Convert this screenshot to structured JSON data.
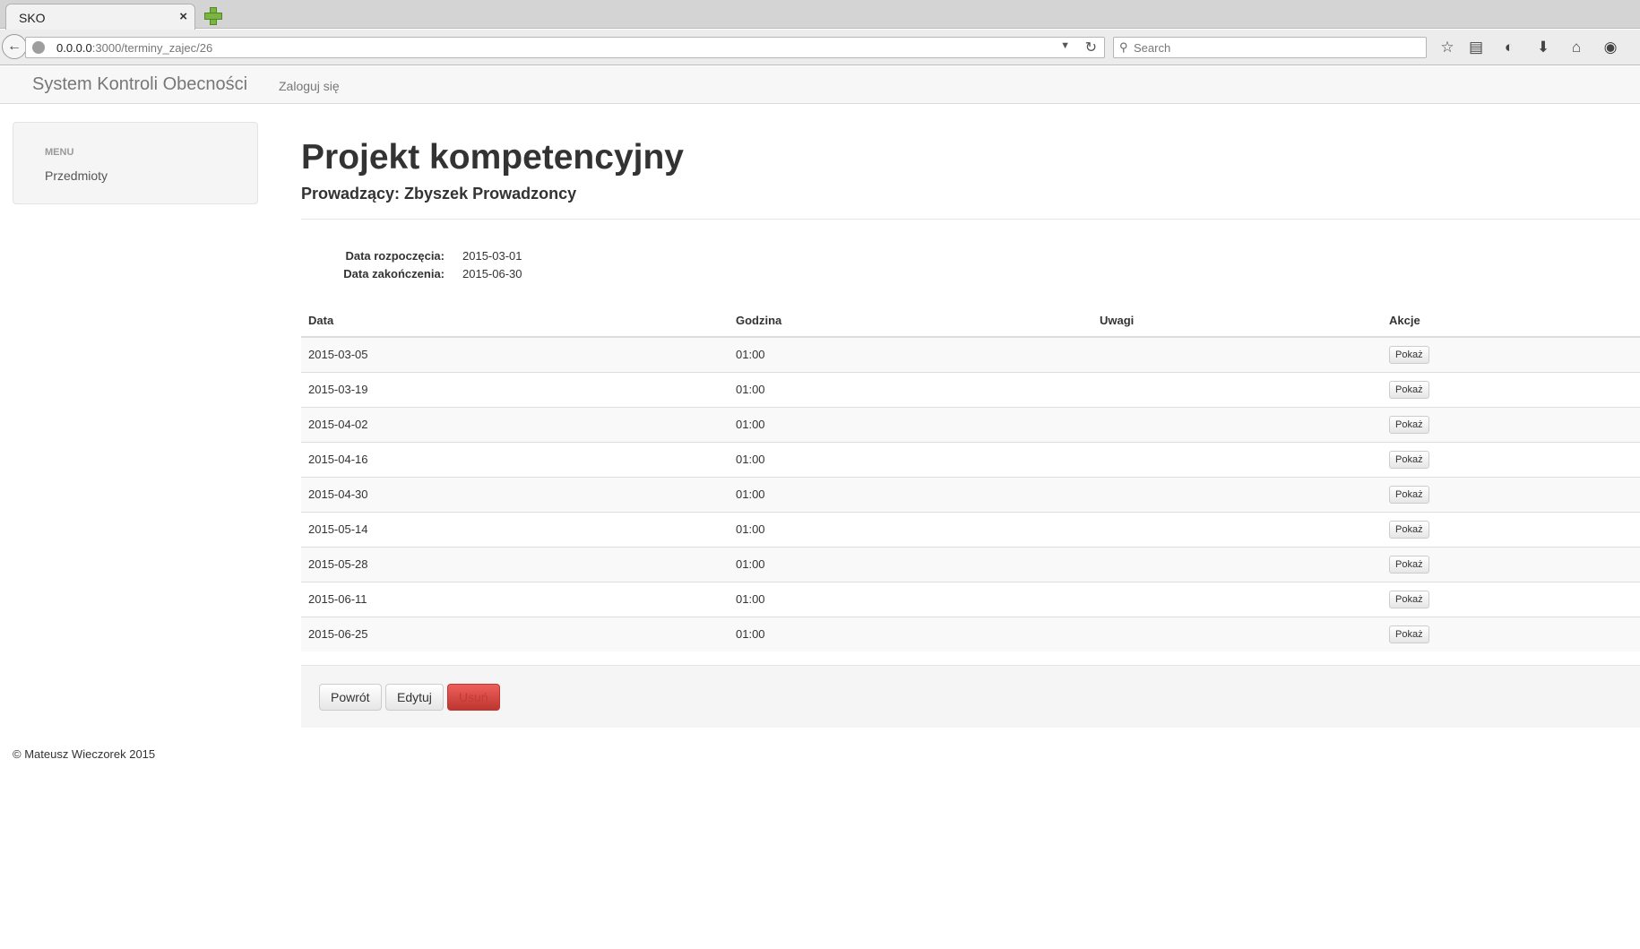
{
  "browser": {
    "tab_title": "SKO",
    "tab_close": "×",
    "url_host": "0.0.0.0",
    "url_path": ":3000/terminy_zajec/26",
    "search_placeholder": "Search"
  },
  "header": {
    "brand": "System Kontroli Obecności",
    "login_link": "Zaloguj się"
  },
  "sidebar": {
    "menu_header": "MENU",
    "items": [
      {
        "label": "Przedmioty"
      }
    ]
  },
  "main": {
    "title": "Projekt kompetencyjny",
    "subtitle": "Prowadzący: Zbyszek Prowadzoncy",
    "details": [
      {
        "label": "Data rozpoczęcia:",
        "value": "2015-03-01"
      },
      {
        "label": "Data zakończenia:",
        "value": "2015-06-30"
      }
    ],
    "table": {
      "headers": [
        "Data",
        "Godzina",
        "Uwagi",
        "Akcje"
      ],
      "rows": [
        {
          "date": "2015-03-05",
          "time": "01:00",
          "notes": "",
          "action": "Pokaż"
        },
        {
          "date": "2015-03-19",
          "time": "01:00",
          "notes": "",
          "action": "Pokaż"
        },
        {
          "date": "2015-04-02",
          "time": "01:00",
          "notes": "",
          "action": "Pokaż"
        },
        {
          "date": "2015-04-16",
          "time": "01:00",
          "notes": "",
          "action": "Pokaż"
        },
        {
          "date": "2015-04-30",
          "time": "01:00",
          "notes": "",
          "action": "Pokaż"
        },
        {
          "date": "2015-05-14",
          "time": "01:00",
          "notes": "",
          "action": "Pokaż"
        },
        {
          "date": "2015-05-28",
          "time": "01:00",
          "notes": "",
          "action": "Pokaż"
        },
        {
          "date": "2015-06-11",
          "time": "01:00",
          "notes": "",
          "action": "Pokaż"
        },
        {
          "date": "2015-06-25",
          "time": "01:00",
          "notes": "",
          "action": "Pokaż"
        }
      ]
    },
    "actions": {
      "back": "Powrót",
      "edit": "Edytuj",
      "delete": "Usuń"
    }
  },
  "footer": {
    "text": "© Mateusz Wieczorek 2015"
  },
  "colors": {
    "danger": "#d9534f",
    "link": "#777777"
  }
}
